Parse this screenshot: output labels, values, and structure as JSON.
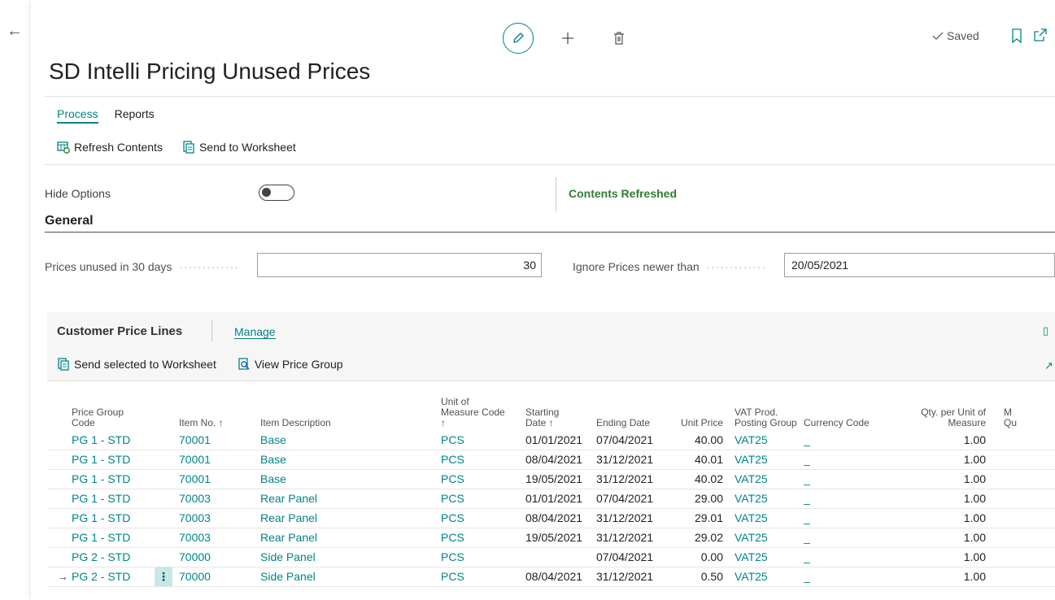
{
  "nav": {
    "back_glyph": "←"
  },
  "toolbar": {
    "saved_label": "Saved"
  },
  "page": {
    "title": "SD Intelli Pricing Unused Prices"
  },
  "tabs": [
    {
      "label": "Process",
      "active": true
    },
    {
      "label": "Reports",
      "active": false
    }
  ],
  "actions": {
    "refresh": "Refresh Contents",
    "send": "Send to Worksheet"
  },
  "options": {
    "hide_label": "Hide Options",
    "hide_on": false,
    "status": "Contents Refreshed",
    "status_color": "#2e7d32"
  },
  "general": {
    "heading": "General",
    "unused_label": "Prices unused in 30 days",
    "unused_value": "30",
    "ignore_label": "Ignore Prices newer than",
    "ignore_value": "20/05/2021"
  },
  "lines": {
    "heading": "Customer Price Lines",
    "manage": "Manage",
    "send_selected": "Send selected to Worksheet",
    "view_group": "View Price Group",
    "headers": {
      "price_group": [
        "Price Group",
        "Code"
      ],
      "item_no": [
        "Item No. ↑"
      ],
      "item_desc": [
        "Item Description"
      ],
      "uom": [
        "Unit of",
        "Measure Code",
        "↑"
      ],
      "start": [
        "Starting",
        "Date ↑"
      ],
      "end": [
        "Ending Date"
      ],
      "unit_price": [
        "Unit Price"
      ],
      "vat": [
        "VAT Prod.",
        "Posting Group"
      ],
      "currency": [
        "Currency Code"
      ],
      "qty_per": [
        "Qty. per Unit of",
        "Measure"
      ],
      "min_qty": [
        "M",
        "Qu"
      ]
    },
    "rows": [
      {
        "pg": "PG 1 - STD",
        "item": "70001",
        "desc": "Base",
        "uom": "PCS",
        "start": "01/01/2021",
        "end": "07/04/2021",
        "price": "40.00",
        "vat": "VAT25",
        "cur": "_",
        "qty": "1.00"
      },
      {
        "pg": "PG 1 - STD",
        "item": "70001",
        "desc": "Base",
        "uom": "PCS",
        "start": "08/04/2021",
        "end": "31/12/2021",
        "price": "40.01",
        "vat": "VAT25",
        "cur": "_",
        "qty": "1.00"
      },
      {
        "pg": "PG 1 - STD",
        "item": "70001",
        "desc": "Base",
        "uom": "PCS",
        "start": "19/05/2021",
        "end": "31/12/2021",
        "price": "40.02",
        "vat": "VAT25",
        "cur": "_",
        "qty": "1.00"
      },
      {
        "pg": "PG 1 - STD",
        "item": "70003",
        "desc": "Rear Panel",
        "uom": "PCS",
        "start": "01/01/2021",
        "end": "07/04/2021",
        "price": "29.00",
        "vat": "VAT25",
        "cur": "_",
        "qty": "1.00"
      },
      {
        "pg": "PG 1 - STD",
        "item": "70003",
        "desc": "Rear Panel",
        "uom": "PCS",
        "start": "08/04/2021",
        "end": "31/12/2021",
        "price": "29.01",
        "vat": "VAT25",
        "cur": "_",
        "qty": "1.00"
      },
      {
        "pg": "PG 1 - STD",
        "item": "70003",
        "desc": "Rear Panel",
        "uom": "PCS",
        "start": "19/05/2021",
        "end": "31/12/2021",
        "price": "29.02",
        "vat": "VAT25",
        "cur": "_",
        "qty": "1.00"
      },
      {
        "pg": "PG 2 - STD",
        "item": "70000",
        "desc": "Side Panel",
        "uom": "PCS",
        "start": "",
        "end": "07/04/2021",
        "price": "0.00",
        "vat": "VAT25",
        "cur": "_",
        "qty": "1.00"
      },
      {
        "pg": "PG 2 - STD",
        "item": "70000",
        "desc": "Side Panel",
        "uom": "PCS",
        "start": "08/04/2021",
        "end": "31/12/2021",
        "price": "0.50",
        "vat": "VAT25",
        "cur": "_",
        "qty": "1.00",
        "current": true
      }
    ]
  },
  "icons": {
    "back": "back-arrow-icon",
    "edit": "pencil-icon",
    "add": "plus-icon",
    "delete": "trash-icon",
    "saved": "check-icon",
    "bookmark": "bookmark-icon",
    "popout": "popout-icon",
    "refresh": "refresh-icon",
    "send": "worksheet-icon",
    "view": "view-group-icon"
  },
  "colors": {
    "accent": "#008489",
    "status_ok": "#2e7d32"
  }
}
